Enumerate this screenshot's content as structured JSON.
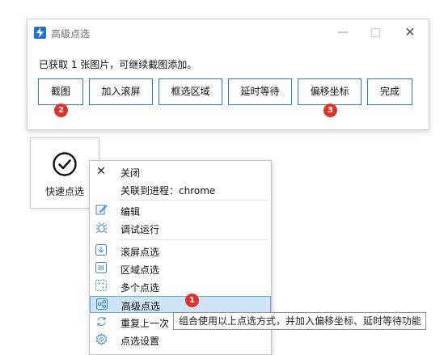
{
  "dialog": {
    "title": "高级点选",
    "message": "已获取 1 张图片，可继续截图添加。",
    "buttons": [
      "截图",
      "加入滚屏",
      "框选区域",
      "延时等待",
      "偏移坐标",
      "完成"
    ],
    "badges": {
      "screenshot": "2",
      "offset": "3"
    }
  },
  "card": {
    "label": "快速点选"
  },
  "menu": {
    "items": [
      {
        "label": "关闭",
        "icon": "close-icon"
      },
      {
        "label": "关联到进程：chrome",
        "icon": ""
      },
      {
        "label": "编辑",
        "icon": "edit-icon"
      },
      {
        "label": "调试运行",
        "icon": "bug-icon"
      },
      {
        "label": "滚屏点选",
        "icon": "scroll-down-icon"
      },
      {
        "label": "区域点选",
        "icon": "region-icon"
      },
      {
        "label": "多个点选",
        "icon": "multi-dot-icon"
      },
      {
        "label": "高级点选",
        "icon": "share-icon"
      },
      {
        "label": "重复上一次",
        "icon": "repeat-icon"
      },
      {
        "label": "点选设置",
        "icon": "gear-icon"
      }
    ],
    "badge": "1",
    "highlight_color": "#cfe4f7"
  },
  "tooltip": {
    "text": "组合使用以上点选方式，并加入偏移坐标、延时等待功能"
  },
  "colors": {
    "accent": "#2e78d6",
    "badge": "#e0332d"
  }
}
